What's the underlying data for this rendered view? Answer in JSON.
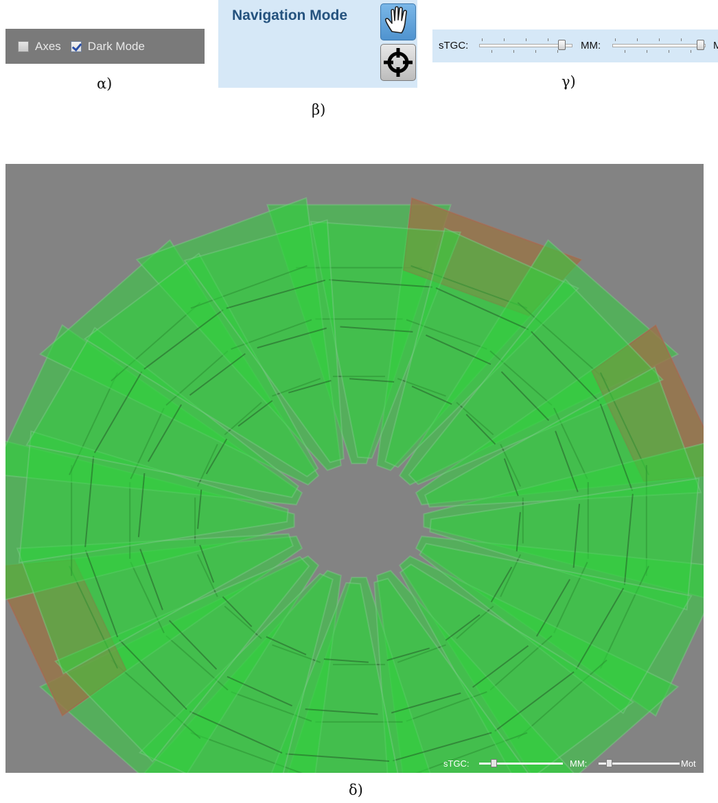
{
  "captions": {
    "a": "α)",
    "b": "β)",
    "g": "γ)",
    "d": "δ)"
  },
  "toolbar": {
    "axes_label": "Axes",
    "axes_checked": false,
    "dark_mode_label": "Dark Mode",
    "dark_mode_checked": true
  },
  "navigation": {
    "title": "Navigation Mode",
    "modes": [
      {
        "name": "pan",
        "icon": "hand-icon",
        "active": true
      },
      {
        "name": "pick",
        "icon": "crosshair-icon",
        "active": false
      }
    ]
  },
  "sliders": {
    "stgc_label": "sTGC:",
    "stgc_value": 0.92,
    "mm_label": "MM:",
    "mm_value": 0.98,
    "cut_label": "M"
  },
  "viewer": {
    "stgc_label": "sTGC:",
    "stgc_value": 0.15,
    "mm_label": "MM:",
    "mm_value": 0.1,
    "cut_label": "Mot"
  },
  "colors": {
    "background": "#838383",
    "chamber_green": "#2fd23c",
    "chamber_red": "#c94a4a",
    "panel_blue": "#d6e8f7"
  }
}
